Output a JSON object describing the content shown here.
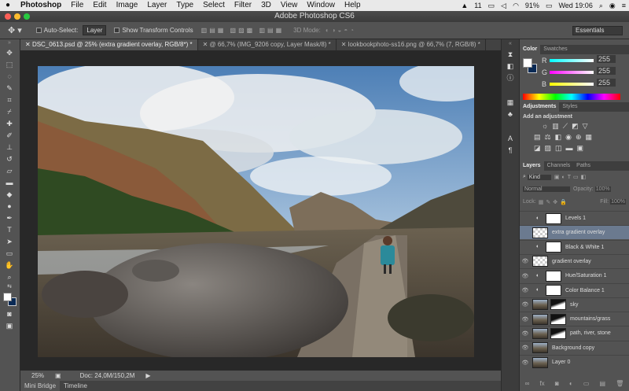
{
  "menubar": {
    "app": "Photoshop",
    "items": [
      "File",
      "Edit",
      "Image",
      "Layer",
      "Type",
      "Select",
      "Filter",
      "3D",
      "View",
      "Window",
      "Help"
    ],
    "status": {
      "adobe_count": "11",
      "battery": "91%",
      "time": "Wed 19:06"
    }
  },
  "window_title": "Adobe Photoshop CS6",
  "options": {
    "auto_select": "Auto-Select:",
    "target": "Layer",
    "show_transform": "Show Transform Controls",
    "mode3d": "3D Mode:",
    "workspace": "Essentials"
  },
  "doc_tabs": [
    "DSC_0613.psd @ 25% (extra gradient overlay, RGB/8*) *",
    "@ 66,7% (IMG_9206 copy, Layer Mask/8) *",
    "lookbookphoto-ss16.png @ 66,7% (7, RGB/8) *"
  ],
  "statusbar": {
    "zoom": "25%",
    "doc": "Doc: 24,0M/150,2M"
  },
  "bottom_tabs": [
    "Mini Bridge",
    "Timeline"
  ],
  "color_panel": {
    "tabs": [
      "Color",
      "Swatches"
    ],
    "channels": [
      {
        "label": "R",
        "value": "255",
        "color": "#ff3030"
      },
      {
        "label": "G",
        "value": "255",
        "color": "#30d030"
      },
      {
        "label": "B",
        "value": "255",
        "color": "#4060ff"
      }
    ]
  },
  "adjustments_panel": {
    "tabs": [
      "Adjustments",
      "Styles"
    ],
    "heading": "Add an adjustment"
  },
  "layers_panel": {
    "tabs": [
      "Layers",
      "Channels",
      "Paths"
    ],
    "kind": "Kind",
    "blend": "Normal",
    "opacity_label": "Opacity:",
    "opacity": "100%",
    "lock_label": "Lock:",
    "fill_label": "Fill:",
    "fill": "100%",
    "layers": [
      {
        "name": "Levels 1",
        "type": "adjustment",
        "visible": false
      },
      {
        "name": "extra gradient overlay",
        "type": "transparent",
        "visible": false,
        "selected": true
      },
      {
        "name": "Black & White 1",
        "type": "adjustment",
        "visible": false
      },
      {
        "name": "gradient overlay",
        "type": "transparent",
        "visible": true
      },
      {
        "name": "Hue/Saturation 1",
        "type": "adjustment",
        "visible": true
      },
      {
        "name": "Color Balance 1",
        "type": "adjustment",
        "visible": true
      },
      {
        "name": "sky",
        "type": "image",
        "visible": true
      },
      {
        "name": "mountains/grass",
        "type": "image",
        "visible": true
      },
      {
        "name": "path, river, stone",
        "type": "image",
        "visible": true
      },
      {
        "name": "Background copy",
        "type": "image",
        "visible": true
      },
      {
        "name": "Layer 0",
        "type": "image",
        "visible": true
      }
    ]
  }
}
